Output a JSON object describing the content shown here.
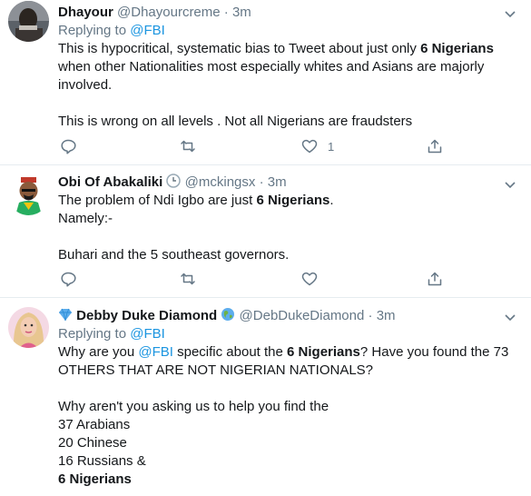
{
  "tweets": [
    {
      "name": "Dhayour",
      "handle": "@Dhayourcreme",
      "dot": "·",
      "time": "3m",
      "replying_prefix": "Replying to",
      "replying_to": "@FBI",
      "line1_pre": "This is hypocritical, systematic bias to Tweet about just only ",
      "line1_bold": "6 Nigerians",
      "line2": "when other Nationalities most especially whites and Asians are majorly",
      "line3": "involved.",
      "line4": "This is wrong on all levels . Not all Nigerians are fraudsters",
      "like_count": "1"
    },
    {
      "name": "Obi Of Abakaliki",
      "handle": "@mckingsx",
      "dot": "·",
      "time": "3m",
      "line1_pre": "The problem of Ndi Igbo are just ",
      "line1_bold": "6 Nigerians",
      "line1_post": ".",
      "line2": "Namely:-",
      "line3": "Buhari and the 5 southeast governors."
    },
    {
      "name": "Debby Duke Diamond",
      "handle": "@DebDukeDiamond",
      "dot": "·",
      "time": "3m",
      "replying_prefix": "Replying to",
      "replying_to": "@FBI",
      "line1_a": "Why are you ",
      "line1_mention": "@FBI",
      "line1_b": " specific about the ",
      "line1_bold": "6 Nigerians",
      "line1_c": "? Have you found the 73",
      "line2": "OTHERS THAT ARE NOT NIGERIAN NATIONALS?",
      "line3": "Why aren't you asking us to help you find the",
      "line4": "37 Arabians",
      "line5": "20 Chinese",
      "line6": "16 Russians &",
      "line7": "6 Nigerians"
    }
  ],
  "icons": [
    "reply-icon",
    "retweet-icon",
    "like-icon",
    "share-icon",
    "caret-down-icon",
    "clock-emoji-icon",
    "diamond-emoji-icon",
    "globe-emoji-icon"
  ],
  "colors": {
    "mention": "#1b95e0",
    "secondary": "#657786",
    "divider": "#e6ecf0"
  }
}
